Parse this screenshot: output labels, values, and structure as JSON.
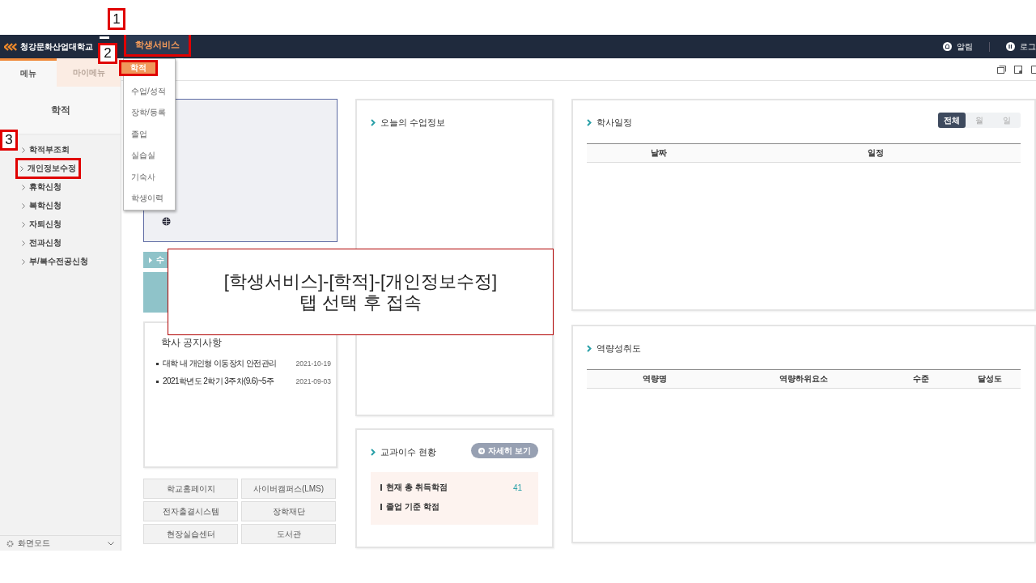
{
  "topbar": {
    "logo": "청강문화산업대학교",
    "nav": [
      {
        "label": "학생서비스",
        "selected": true,
        "highlighted": true
      }
    ],
    "alerts": "알림",
    "logout": "로그"
  },
  "sidebar": {
    "tabs": [
      {
        "label": "메뉴",
        "selected": true
      },
      {
        "label": "마이메뉴",
        "selected": false
      }
    ],
    "title": "학적",
    "items": [
      {
        "label": "학적부조회",
        "highlighted": false
      },
      {
        "label": "개인정보수정",
        "highlighted": true
      },
      {
        "label": "휴학신청",
        "highlighted": false
      },
      {
        "label": "복학신청",
        "highlighted": false
      },
      {
        "label": "자퇴신청",
        "highlighted": false
      },
      {
        "label": "전과신청",
        "highlighted": false
      },
      {
        "label": "부/복수전공신청",
        "highlighted": false
      }
    ],
    "footer": "화면모드"
  },
  "dropdown": {
    "items": [
      {
        "label": "학적",
        "selected": true,
        "highlighted": true
      },
      {
        "label": "수업/성적",
        "selected": false,
        "highlighted": false
      },
      {
        "label": "장학/등록",
        "selected": false,
        "highlighted": false
      },
      {
        "label": "졸업",
        "selected": false,
        "highlighted": false
      },
      {
        "label": "실습실",
        "selected": false,
        "highlighted": false
      },
      {
        "label": "기숙사",
        "selected": false,
        "highlighted": false
      },
      {
        "label": "학생이력",
        "selected": false,
        "highlighted": false
      }
    ]
  },
  "quick_bar": {
    "label": "수"
  },
  "notices": {
    "title": "학사 공지사항",
    "items": [
      {
        "title": "대학 내 개인형 이동장치 안전관리",
        "date": "2021-10-19"
      },
      {
        "title": "2021학년도 2학기 3주차(9.6)~5주",
        "date": "2021-09-03"
      }
    ]
  },
  "links": [
    "학교홈페이지",
    "사이버캠퍼스(LMS)",
    "전자출결시스템",
    "장학재단",
    "현장실습센터",
    "도서관"
  ],
  "today_class": {
    "title": "오늘의 수업정보"
  },
  "credits": {
    "title": "교과이수 현황",
    "button": "자세히 보기",
    "rows": [
      {
        "label": "현재 총 취득학점",
        "value": "41"
      },
      {
        "label": "졸업 기준 학점"
      }
    ]
  },
  "schedule": {
    "title": "학사일정",
    "filters": [
      {
        "label": "전체",
        "selected": true
      },
      {
        "label": "월",
        "selected": false
      },
      {
        "label": "일",
        "selected": false
      }
    ],
    "columns": [
      "날짜",
      "일정"
    ]
  },
  "competency": {
    "title": "역량성취도",
    "columns": [
      "역량명",
      "역량하위요소",
      "수준",
      "달성도"
    ]
  },
  "annotations": {
    "markers": [
      "1",
      "2",
      "3"
    ],
    "callout": "[학생서비스]-[학적]-[개인정보수정]\n탭 선택 후 접속"
  }
}
